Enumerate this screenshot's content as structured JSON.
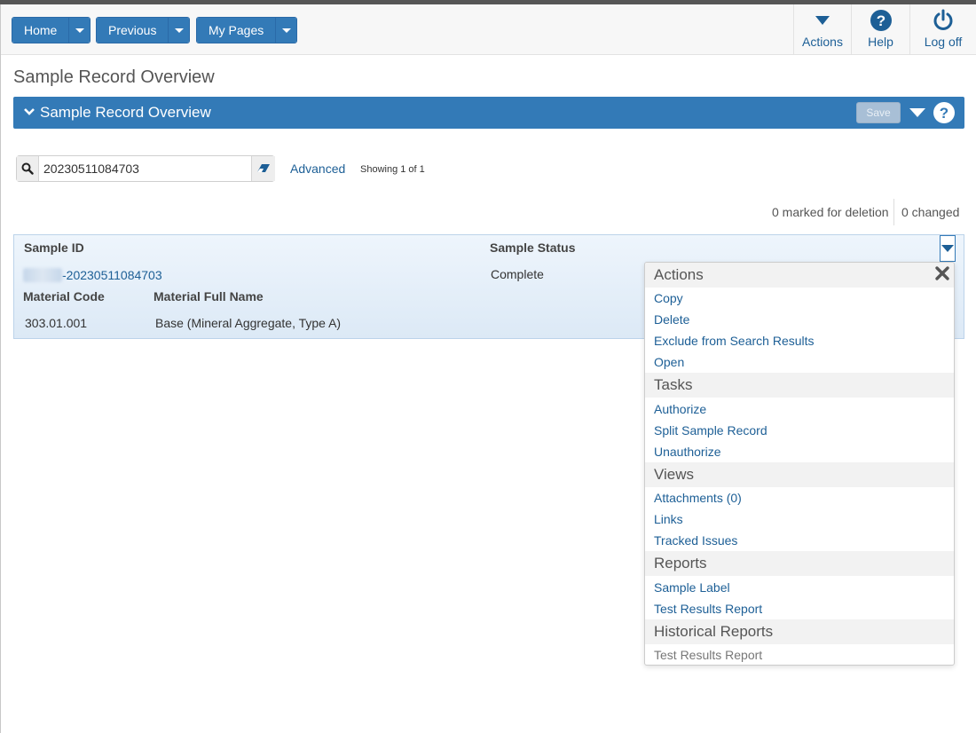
{
  "nav": {
    "home": "Home",
    "previous": "Previous",
    "my_pages": "My Pages",
    "actions": "Actions",
    "help": "Help",
    "logoff": "Log off"
  },
  "page": {
    "title": "Sample Record Overview"
  },
  "panel": {
    "title": "Sample Record Overview",
    "save": "Save"
  },
  "search": {
    "value": "20230511084703",
    "advanced": "Advanced",
    "showing": "Showing 1 of 1"
  },
  "status": {
    "marked_for_deletion": "0 marked for deletion",
    "changed": "0 changed"
  },
  "grid": {
    "headers": {
      "sample_id": "Sample ID",
      "sample_status": "Sample Status",
      "material_code": "Material Code",
      "material_full_name": "Material Full Name"
    },
    "row": {
      "sample_id": "-20230511084703",
      "sample_status": "Complete",
      "material_code": "303.01.001",
      "material_full_name": "Base (Mineral Aggregate, Type A)"
    }
  },
  "menu": {
    "actions": {
      "title": "Actions",
      "items": [
        "Copy",
        "Delete",
        "Exclude from Search Results",
        "Open"
      ]
    },
    "tasks": {
      "title": "Tasks",
      "items": [
        "Authorize",
        "Split Sample Record",
        "Unauthorize"
      ]
    },
    "views": {
      "title": "Views",
      "items": [
        "Attachments (0)",
        "Links",
        "Tracked Issues"
      ]
    },
    "reports": {
      "title": "Reports",
      "items": [
        "Sample Label",
        "Test Results Report"
      ]
    },
    "historical": {
      "title": "Historical Reports",
      "items": [
        "Test Results Report"
      ]
    }
  },
  "colors": {
    "accent": "#337ab7",
    "link": "#1d5f96",
    "grid_bg": "#dce9f6"
  },
  "icons": {
    "search": "search-icon",
    "eraser": "eraser-icon",
    "help": "help-circle-icon",
    "logoff": "power-icon",
    "actions": "caret-down-icon",
    "close": "close-icon",
    "chevron": "chevron-down-icon"
  }
}
